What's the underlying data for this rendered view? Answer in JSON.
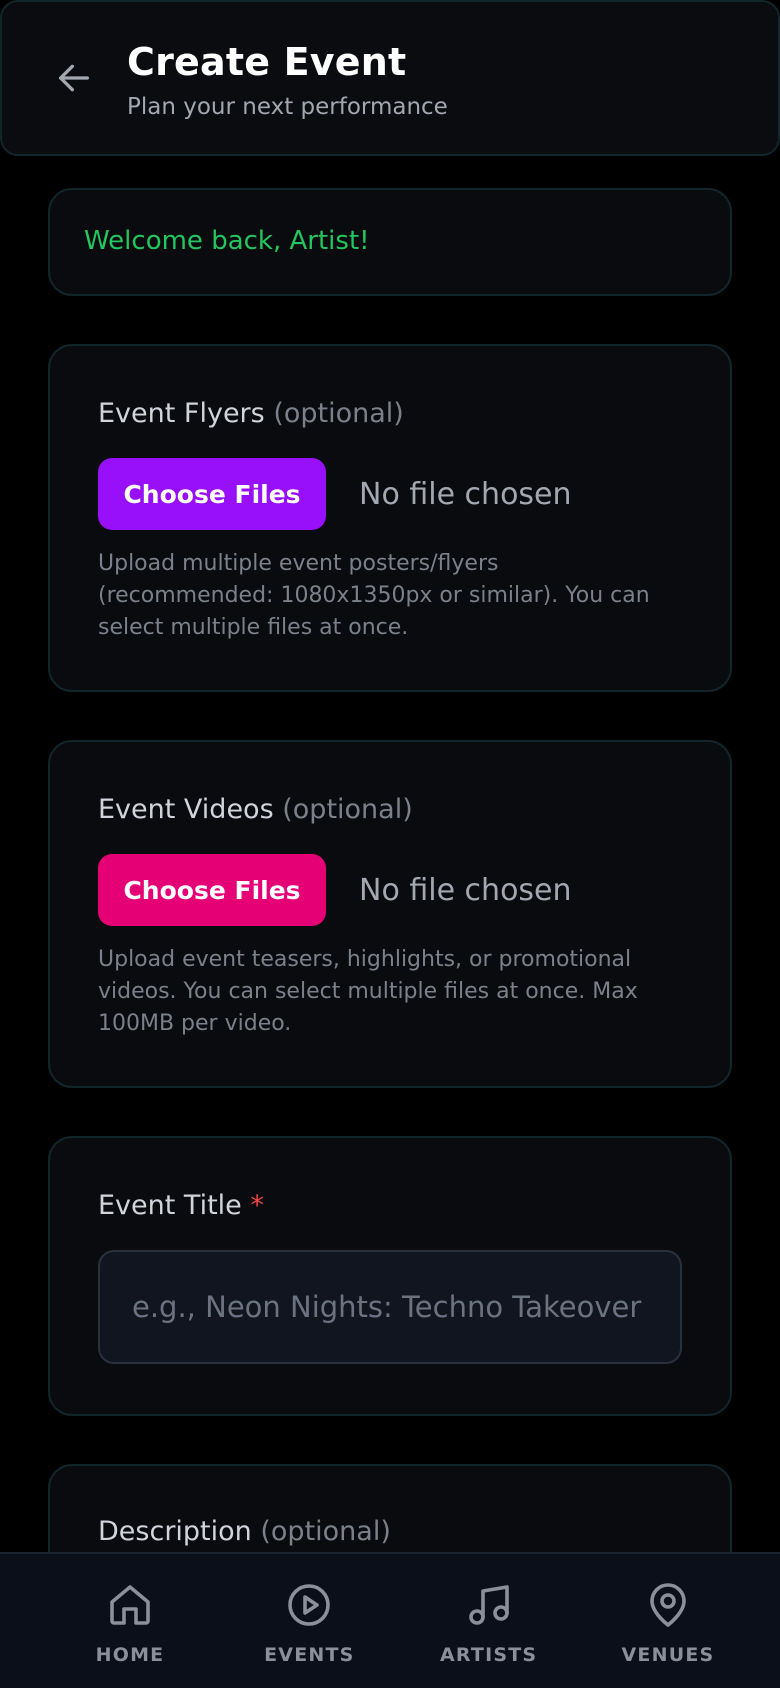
{
  "header": {
    "title": "Create Event",
    "subtitle": "Plan your next performance"
  },
  "welcome": {
    "message": "Welcome back, Artist!"
  },
  "flyers": {
    "label": "Event Flyers",
    "optional": "(optional)",
    "button_label": "Choose Files",
    "status": "No file chosen",
    "hint": "Upload multiple event posters/flyers (recommended: 1080x1350px or similar). You can select multiple files at once."
  },
  "videos": {
    "label": "Event Videos",
    "optional": "(optional)",
    "button_label": "Choose Files",
    "status": "No file chosen",
    "hint": "Upload event teasers, highlights, or promotional videos. You can select multiple files at once. Max 100MB per video."
  },
  "event_title": {
    "label": "Event Title",
    "required_mark": "*",
    "placeholder": "e.g., Neon Nights: Techno Takeover"
  },
  "description": {
    "label": "Description",
    "optional": "(optional)"
  },
  "nav": {
    "home": "HOME",
    "events": "EVENTS",
    "artists": "ARTISTS",
    "venues": "VENUES"
  },
  "colors": {
    "accent_green": "#22c55e",
    "flyers_button": "#9810fa",
    "videos_button": "#e60076",
    "required": "#ef4444"
  }
}
